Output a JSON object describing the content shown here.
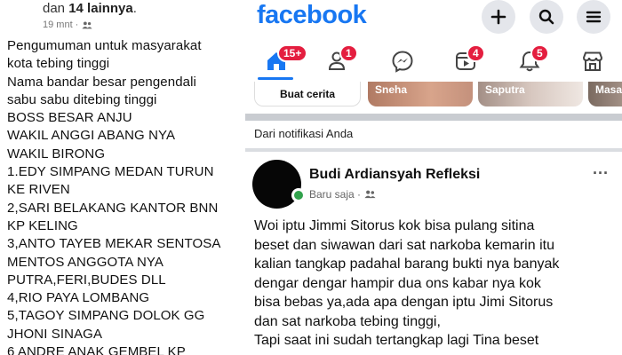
{
  "left_post": {
    "tagline_prefix": "dan ",
    "tagline_bold": "14 lainnya",
    "tagline_suffix": ".",
    "time": "19 mnt ·",
    "lines": [
      "Pengumuman untuk masyarakat",
      "kota tebing tinggi",
      "Nama bandar besar pengendali",
      "sabu sabu ditebing tinggi",
      "BOSS BESAR ANJU",
      "WAKIL ANGGI ABANG NYA",
      "WAKIL BIRONG",
      "1.EDY SIMPANG MEDAN TURUN",
      "KE RIVEN",
      "2,SARI BELAKANG KANTOR BNN",
      "KP KELING",
      "3,ANTO TAYEB MEKAR  SENTOSA",
      "MENTOS ANGGOTA NYA",
      "PUTRA,FERI,BUDES DLL",
      "4,RIO PAYA LOMBANG",
      "5,TAGOY SIMPANG DOLOK GG",
      "JHONI SINAGA",
      "6 ANDRE ANAK GEMBEL KP"
    ]
  },
  "header": {
    "logo": "facebook",
    "create_icon": "plus-icon",
    "search_icon": "search-icon",
    "menu_icon": "hamburger-menu-icon"
  },
  "nav": {
    "home_badge": "15+",
    "friends_badge": "1",
    "video_badge": "4",
    "notifications_badge": "5"
  },
  "stories": {
    "create_label": "Buat cerita",
    "items": [
      "Sneha",
      "Saputra",
      "Masa"
    ]
  },
  "feed": {
    "section_label": "Dari notifikasi Anda",
    "author": "Budi Ardiansyah Refleksi",
    "timestamp": "Baru saja ·",
    "more": "···",
    "body_lines": [
      "Woi iptu Jimmi Sitorus kok bisa pulang sitina",
      "beset dan siwawan dari sat narkoba kemarin itu",
      "kalian tangkap padahal barang bukti nya banyak",
      "dengar dengar hampir dua ons kabar nya kok",
      "bisa bebas ya,ada apa dengan iptu Jimi Sitorus",
      "dan sat narkoba tebing tinggi,",
      "Tapi saat ini sudah tertangkap lagi Tina beset"
    ]
  },
  "colors": {
    "brand": "#1877f2",
    "badge": "#e41e3f",
    "online": "#31a24c"
  }
}
